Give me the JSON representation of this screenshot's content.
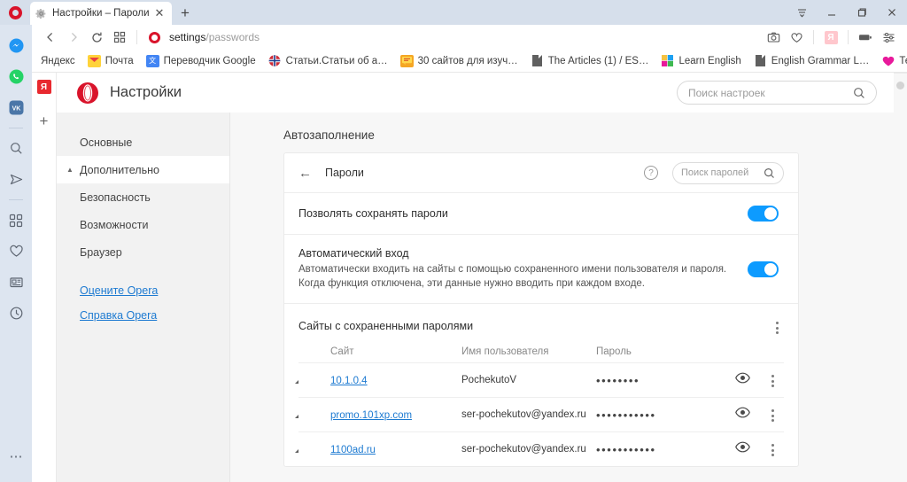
{
  "window": {
    "tab": {
      "title": "Настройки – Пароли",
      "icon": "gear-icon",
      "close": "✕"
    },
    "new_tab": "+",
    "controls": {
      "list": "≡",
      "minimize": "—",
      "maximize": "❐",
      "close": "✕"
    }
  },
  "navbar": {
    "back": "‹",
    "forward": "›",
    "reload": "⟳",
    "speeddial": "grid-icon",
    "url_prefix": "settings",
    "url_suffix": "/passwords",
    "right_icons": [
      "camera-icon",
      "heart-icon",
      "yandex-badge",
      "vpn-battery-icon",
      "easy-setup-icon"
    ],
    "yandex_badge_label": "Я"
  },
  "bookmarks": {
    "items": [
      {
        "label": "Яндекс",
        "icon": "none",
        "color": ""
      },
      {
        "label": "Почта",
        "icon": "envelope",
        "color": "#ffd33a"
      },
      {
        "label": "Переводчик Google",
        "icon": "translate",
        "color": "#4285f4"
      },
      {
        "label": "Статьи.Статьи об а…",
        "icon": "uk-flag",
        "color": "#cf2b37"
      },
      {
        "label": "30 сайтов для изуч…",
        "icon": "speech",
        "color": "#f5a623"
      },
      {
        "label": "The Articles (1) / ES…",
        "icon": "doc",
        "color": "#606060"
      },
      {
        "label": "Learn English",
        "icon": "squares",
        "color": "#f5c242"
      },
      {
        "label": "English Grammar L…",
        "icon": "doc",
        "color": "#606060"
      },
      {
        "label": "Тесты по английск…",
        "icon": "heart",
        "color": "#e8199b"
      }
    ],
    "overflow": "»"
  },
  "sidebar": {
    "items": [
      {
        "name": "messenger-icon",
        "color": "#2196f3"
      },
      {
        "name": "whatsapp-icon",
        "color": "#25d366"
      },
      {
        "name": "vk-icon",
        "color": "#4a76a8",
        "label": "VK"
      },
      {
        "name": "separator"
      },
      {
        "name": "search-icon"
      },
      {
        "name": "send-icon"
      },
      {
        "name": "separator"
      },
      {
        "name": "speeddial-grid-icon"
      },
      {
        "name": "favorites-heart-icon"
      },
      {
        "name": "news-icon"
      },
      {
        "name": "history-clock-icon"
      }
    ],
    "bottom": "⋯"
  },
  "panel": {
    "yandex_label": "Я",
    "add": "+"
  },
  "settings": {
    "header": {
      "title": "Настройки",
      "search_placeholder": "Поиск настроек",
      "search_value": ""
    },
    "nav": [
      {
        "label": "Основные",
        "active": false,
        "caret": false,
        "type": "item"
      },
      {
        "label": "Дополнительно",
        "active": true,
        "caret": true,
        "type": "item"
      },
      {
        "label": "Безопасность",
        "active": false,
        "caret": false,
        "type": "sub"
      },
      {
        "label": "Возможности",
        "active": false,
        "caret": false,
        "type": "sub"
      },
      {
        "label": "Браузер",
        "active": false,
        "caret": false,
        "type": "sub"
      }
    ],
    "nav_links": [
      {
        "label": "Оцените Opera"
      },
      {
        "label": "Справка Opera"
      }
    ],
    "section_title": "Автозаполнение",
    "card": {
      "back": "←",
      "title": "Пароли",
      "help": "?",
      "search_placeholder": "Поиск паролей",
      "search_value": "",
      "toggles": [
        {
          "title": "Позволять сохранять пароли",
          "desc": "",
          "on": true,
          "accent": "#0d9bff"
        },
        {
          "title": "Автоматический вход",
          "desc": "Автоматически входить на сайты с помощью сохраненного имени пользователя и пароля.\nКогда функция отключена, эти данные нужно вводить при каждом входе.",
          "on": true,
          "accent": "#0d9bff"
        }
      ],
      "saved": {
        "title": "Сайты с сохраненными паролями",
        "columns": {
          "site": "Сайт",
          "username": "Имя пользователя",
          "password": "Пароль"
        },
        "rows": [
          {
            "site": "10.1.0.4",
            "username": "PochekutoV",
            "password": "••••••••"
          },
          {
            "site": "promo.101xp.com",
            "username": "ser-pochekutov@yandex.ru",
            "password": "•••••••••••"
          },
          {
            "site": "1100ad.ru",
            "username": "ser-pochekutov@yandex.ru",
            "password": "•••••••••••"
          }
        ]
      }
    }
  }
}
